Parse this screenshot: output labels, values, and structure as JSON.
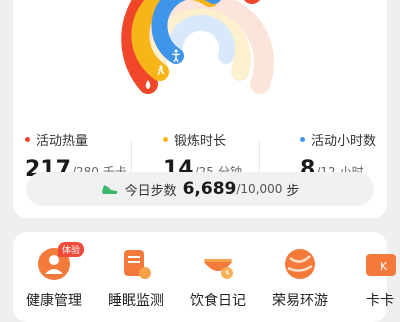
{
  "metrics": [
    {
      "label": "活动热量",
      "value": "217",
      "goal": "/280",
      "unit": "千卡",
      "color": "#f0472b"
    },
    {
      "label": "锻炼时长",
      "value": "14",
      "goal": "/25",
      "unit": "分钟",
      "color": "#f7b519"
    },
    {
      "label": "活动小时数",
      "value": "8",
      "goal": "/12",
      "unit": "小时",
      "color": "#3f95ea"
    }
  ],
  "steps": {
    "label": "今日步数",
    "value": "6,689",
    "goal": "/10,000",
    "unit": "步"
  },
  "features": [
    {
      "name": "健康管理",
      "badge": "体验",
      "icon": "health-management-icon"
    },
    {
      "name": "睡眠监测",
      "icon": "sleep-monitor-icon"
    },
    {
      "name": "饮食日记",
      "icon": "diet-diary-icon"
    },
    {
      "name": "荣易环游",
      "icon": "travel-globe-icon"
    },
    {
      "name": "卡卡",
      "icon": "card-icon"
    }
  ],
  "rings": {
    "calories_progress": 0.775,
    "exercise_progress": 0.56,
    "hours_progress": 0.667
  }
}
